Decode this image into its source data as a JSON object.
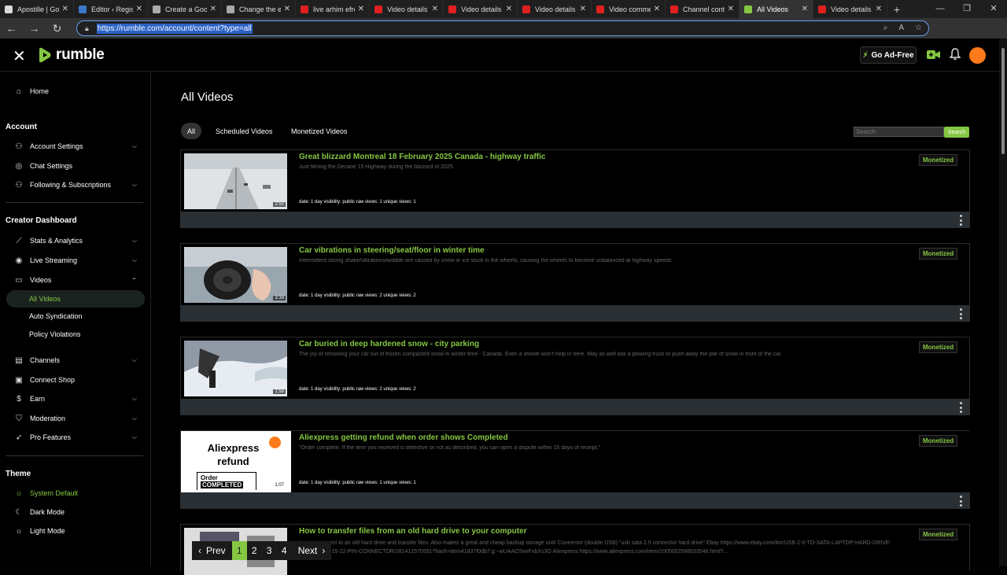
{
  "browser": {
    "tabs": [
      {
        "label": "Apostille | Gouv",
        "color": "#d9d9d9"
      },
      {
        "label": "Editor ‹ Regist",
        "color": "#3c78c8"
      },
      {
        "label": "Create a Googl",
        "color": "#aaaaaa"
      },
      {
        "label": "Change the em",
        "color": "#aaaaaa"
      },
      {
        "label": "live arhim efre",
        "color": "#e02020"
      },
      {
        "label": "Video details -",
        "color": "#e02020"
      },
      {
        "label": "Video details -",
        "color": "#e02020"
      },
      {
        "label": "Video details -",
        "color": "#e02020"
      },
      {
        "label": "Video commen",
        "color": "#e02020"
      },
      {
        "label": "Channel conte",
        "color": "#e02020"
      },
      {
        "label": "All Videos",
        "color": "#85c742",
        "active": true
      },
      {
        "label": "Video details -",
        "color": "#e02020"
      }
    ],
    "url": "https://rumble.com/account/content?type=all"
  },
  "header": {
    "logo_text": "rumble",
    "go_ad_free": "Go Ad-Free"
  },
  "sidebar": {
    "home": "Home",
    "account_heading": "Account",
    "account_settings": "Account Settings",
    "chat_settings": "Chat Settings",
    "following": "Following & Subscriptions",
    "creator_heading": "Creator Dashboard",
    "stats": "Stats & Analytics",
    "live": "Live Streaming",
    "videos": "Videos",
    "all_videos": "All Videos",
    "auto_syndication": "Auto Syndication",
    "policy_violations": "Policy Violations",
    "channels": "Channels",
    "connect_shop": "Connect Shop",
    "earn": "Earn",
    "moderation": "Moderation",
    "pro_features": "Pro Features",
    "theme_heading": "Theme",
    "system_default": "System Default",
    "dark_mode": "Dark Mode",
    "light_mode": "Light Mode"
  },
  "main": {
    "title": "All Videos",
    "filters": [
      "All",
      "Scheduled Videos",
      "Monetized Videos"
    ],
    "search_placeholder": "Search",
    "search_button": "Search",
    "videos": [
      {
        "title": "Great blizzard Montreal 18 February 2025 Canada - highway traffic",
        "description": "Just filming the Decarie 15 Highway during the blizzard of 2025.",
        "meta": "date: 1 day  visibility: public  raw views: 1  unique views: 1",
        "duration": "2:50",
        "badge": "Monetized"
      },
      {
        "title": "Car vibrations in steering/seat/floor in winter time",
        "description": "Intermittent strong shake/vibrations/wobble are caused by snow or ice stuck in the wheels, causing the wheels to become unbalanced at highway speeds",
        "meta": "date: 1 day  visibility: public  raw views: 2  unique views: 2",
        "duration": "3:39",
        "badge": "Monetized"
      },
      {
        "title": "Car buried in deep hardened snow - city parking",
        "description": "The joy of removing your car out of frozen compacted snow in winter time - Canada. Even a shovel won't help in here. May as well ask a plowing truck to push away the pile of snow in front of the car.",
        "meta": "date: 1 day  visibility: public  raw views: 2  unique views: 2",
        "duration": "1:58",
        "badge": "Monetized"
      },
      {
        "title": "Aliexpress getting refund when order shows Completed",
        "description": "\"Order complete. If the item you received is defective or not as described, you can open a dispute within 15 days of receipt.\"",
        "meta": "date: 1 day  visibility: public  raw views: 1  unique views: 1",
        "duration": "1:07",
        "badge": "Monetized",
        "thumb_text": {
          "line1": "Aliexpress",
          "line2": "refund",
          "box1": "Order",
          "box2": "COMPLETED"
        }
      },
      {
        "title": "How to transfer files from an old hard drive to your computer",
        "description": "How to connect to an old hard drive and transfer files. Also makes a great and cheap backup storage unit! Connector (double USB) \"usb sata 2.5 connector hard drive\" Ebay https://www.ebay.com/itm/USB-2-0-TO-SATA-LAPTOP-HARD-DRIVE-ADAPTER-7-15-22-PIN-CONNECTOR/281412570551?hash=item41837f0db7:g:~wUAAOSwrFxbXs3O Aliexpress https://www.aliexpress.com/item/1005002588533546.html?...",
        "meta": "",
        "duration": "",
        "badge": "Monetized"
      }
    ]
  },
  "pager": {
    "prev": "Prev",
    "pages": [
      "1",
      "2",
      "3",
      "4"
    ],
    "next": "Next"
  },
  "colors": {
    "accent": "#85c742",
    "avatar": "#ff7a1a"
  }
}
